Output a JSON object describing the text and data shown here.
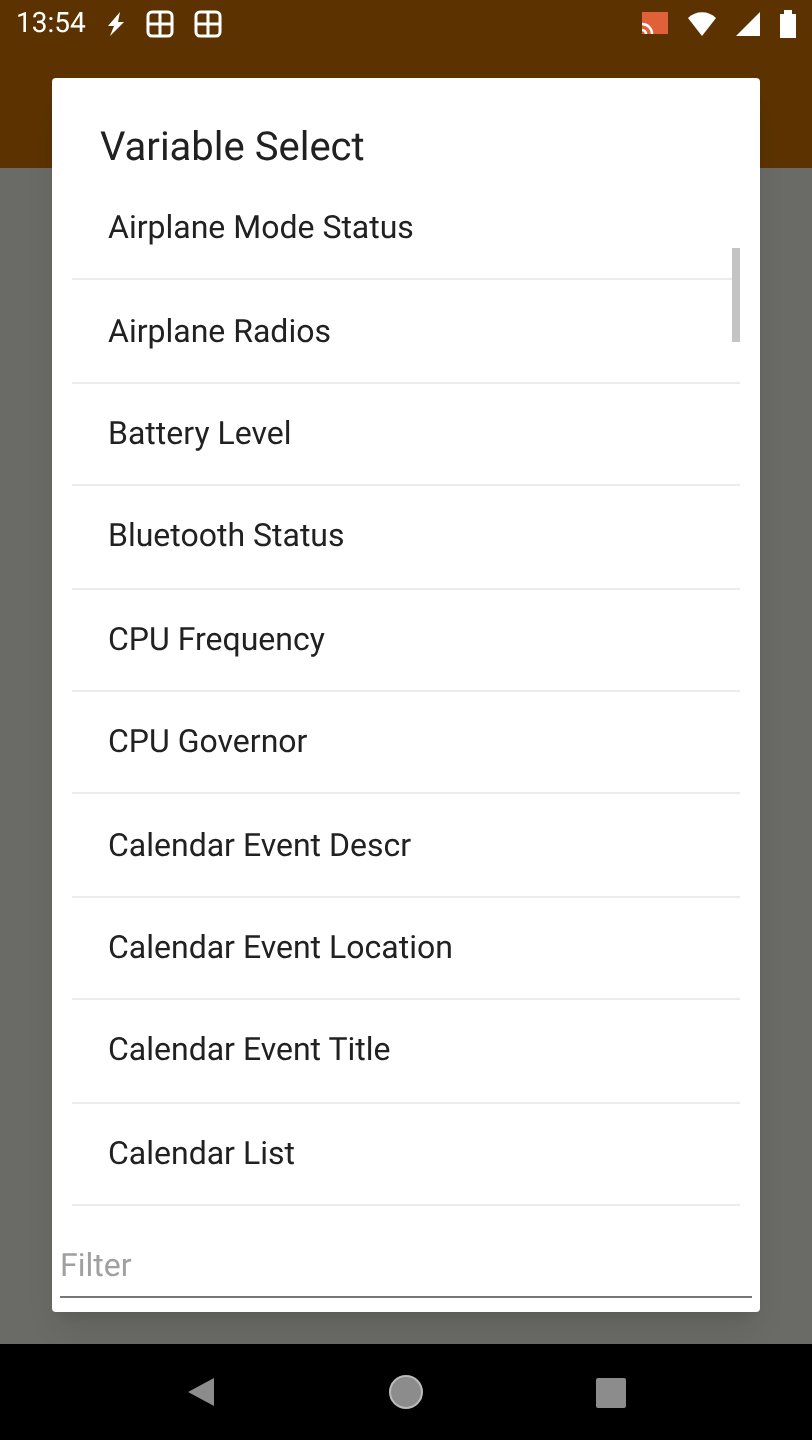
{
  "status_bar": {
    "time": "13:54"
  },
  "dialog": {
    "title": "Variable Select",
    "items": [
      "Airplane Mode Status",
      "Airplane Radios",
      "Battery Level",
      "Bluetooth Status",
      "CPU Frequency",
      "CPU Governor",
      "Calendar Event Descr",
      "Calendar Event Location",
      "Calendar Event Title",
      "Calendar List"
    ],
    "filter": {
      "placeholder": "Filter"
    }
  }
}
